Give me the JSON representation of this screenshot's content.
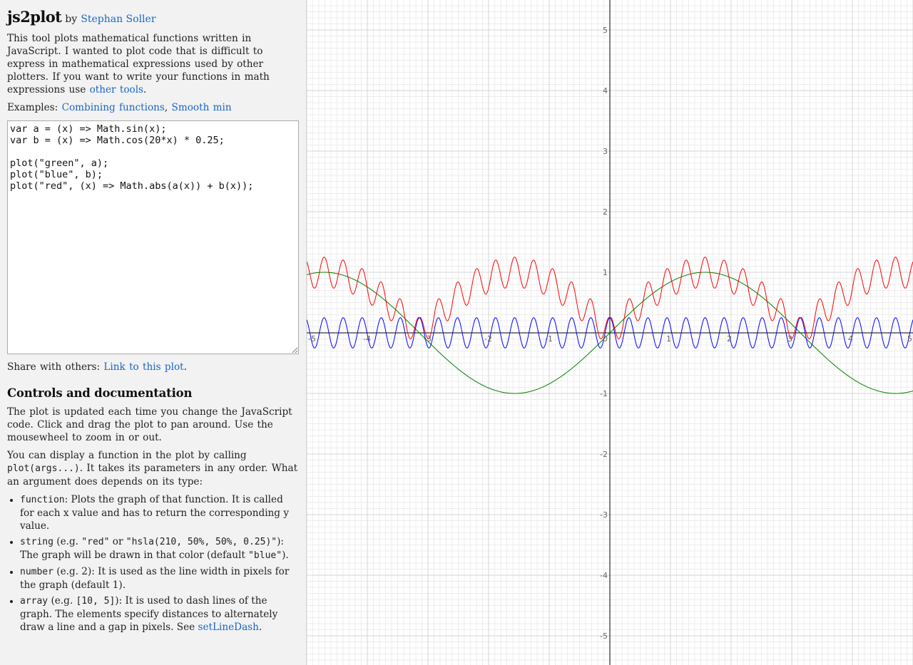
{
  "header": {
    "title": "js2plot",
    "by": "by",
    "author_link": "Stephan Soller"
  },
  "intro": {
    "text": "This tool plots mathematical functions written in JavaScript. I wanted to plot code that is difficult to express in mathematical expressions used by other plotters. If you want to write your functions in math expressions use ",
    "link": "other tools",
    "end": "."
  },
  "examples": {
    "label": "Examples:",
    "items": [
      "Combining functions",
      "Smooth min"
    ],
    "separator": ","
  },
  "editor": {
    "code": "var a = (x) => Math.sin(x);\nvar b = (x) => Math.cos(20*x) * 0.25;\n\nplot(\"green\", a);\nplot(\"blue\", b);\nplot(\"red\", (x) => Math.abs(a(x)) + b(x));"
  },
  "share": {
    "label": "Share with others:",
    "link": "Link to this plot",
    "end": "."
  },
  "docs": {
    "heading": "Controls and documentation",
    "para1": "The plot is updated each time you change the JavaScript code. Click and drag the plot to pan around. Use the mousewheel to zoom in or out.",
    "para2_a": "You can display a function in the plot by calling ",
    "para2_code": "plot(args...)",
    "para2_b": ". It takes its parameters in any order. What an argument does depends on its type:",
    "items": [
      {
        "code": "function",
        "text": ": Plots the graph of that function. It is called for each x value and has to return the corresponding y value."
      },
      {
        "code": "string",
        "text_a": " (e.g. ",
        "code2": "\"red\"",
        "text_b": " or ",
        "code3": "\"hsla(210, 50%, 50%, 0.25)\"",
        "text_c": "): The graph will be drawn in that color (default ",
        "code4": "\"blue\"",
        "text_d": ")."
      },
      {
        "code": "number",
        "text": " (e.g. 2): It is used as the line width in pixels for the graph (default 1)."
      },
      {
        "code": "array",
        "text_a": " (e.g. ",
        "code2": "[10, 5]",
        "text_b": "): It is used to dash lines of the graph. The elements specify distances to alternately draw a line and a gap in pixels. See ",
        "link": "setLineDash",
        "text_c": "."
      }
    ]
  },
  "chart_data": {
    "type": "line",
    "xlim": [
      -5,
      5
    ],
    "ylim": [
      -5.5,
      5.5
    ],
    "x_ticks": [
      -5,
      -4,
      -3,
      -2,
      -1,
      0,
      1,
      2,
      3,
      4,
      5
    ],
    "y_ticks": [
      -5,
      -4,
      -3,
      -2,
      -1,
      1,
      2,
      3,
      4,
      5
    ],
    "grid": true,
    "series": [
      {
        "color": "#008000",
        "expr": "sin(x)"
      },
      {
        "color": "#0000ff",
        "expr": "cos(20*x) * 0.25"
      },
      {
        "color": "#ff0000",
        "expr": "|sin(x)| + cos(20*x) * 0.25"
      }
    ]
  }
}
